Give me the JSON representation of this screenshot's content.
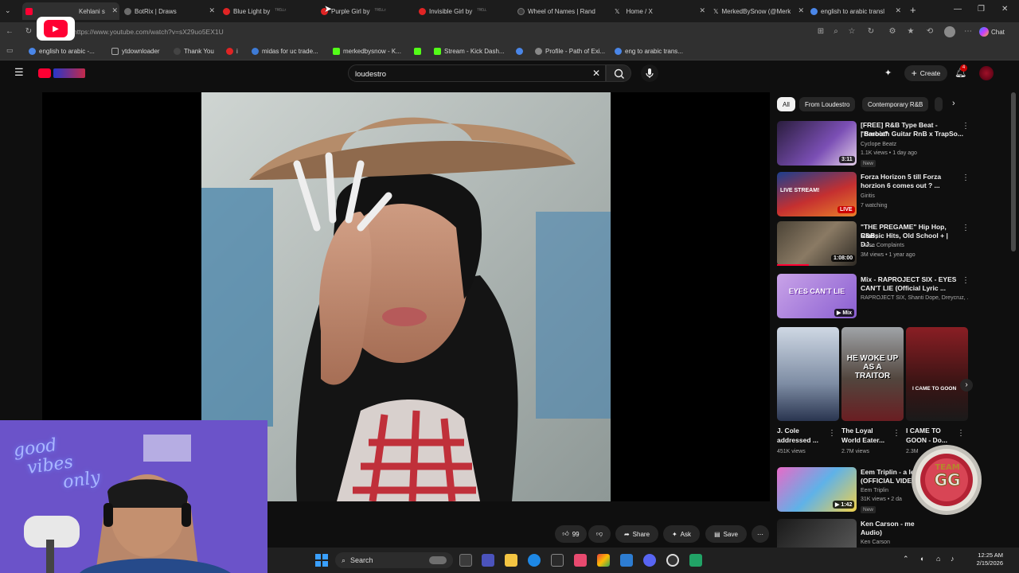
{
  "browser": {
    "tabs": [
      {
        "label": "Kehlani s",
        "color": "#ff0033"
      },
      {
        "label": "BotRix | Draws",
        "color": "#6c6c6c"
      },
      {
        "label": "Blue Light by",
        "color": "#e02424"
      },
      {
        "label": "Purple Girl by",
        "color": "#e02424"
      },
      {
        "label": "Invisible Girl by",
        "color": "#e02424"
      },
      {
        "label": "Wheel of Names | Rand",
        "color": "#3b3b3b"
      },
      {
        "label": "Home / X",
        "color": "#222222"
      },
      {
        "label": "MerkedBySnow (@Merk",
        "color": "#222222"
      },
      {
        "label": "english to arabic transl",
        "color": "#4a86e8"
      }
    ],
    "url": "https://www.youtube.com/watch?v=sX29uo5EX1U",
    "chat_label": "Chat",
    "bookmarks": [
      {
        "label": "english to arabic -...",
        "color": "#4a86e8"
      },
      {
        "label": "ytdownloader",
        "color": "#888888"
      },
      {
        "label": "Thank You",
        "color": "#444444"
      },
      {
        "label": "i",
        "color": "#e02424"
      },
      {
        "label": "midas for uc trade...",
        "color": "#3e7bd6"
      },
      {
        "label": "merkedbysnow - K...",
        "color": "#53fc18"
      },
      {
        "label": "",
        "color": "#53fc18"
      },
      {
        "label": "Stream - Kick Dash...",
        "color": "#53fc18"
      },
      {
        "label": "",
        "color": "#4a86e8"
      },
      {
        "label": "Profile - Path of Exi...",
        "color": "#888888"
      },
      {
        "label": "eng to arabic trans...",
        "color": "#4a86e8"
      }
    ]
  },
  "youtube": {
    "search_value": "loudestro",
    "create_label": "Create",
    "notification_count": "4",
    "chips": [
      "All",
      "From Loudestro",
      "Contemporary R&B"
    ],
    "actions": {
      "like_count": "99",
      "share_label": "Share",
      "ask_label": "Ask",
      "save_label": "Save"
    },
    "recommendations": [
      {
        "title": "[FREE] R&B Type Beat - \"Barbie\"",
        "title2": "| Smooth Guitar RnB x TrapSo...",
        "channel": "Cyclope Beatz",
        "meta": "1.1K views • 1 day ago",
        "badge": "New",
        "duration": "3:11"
      },
      {
        "title": "Forza Horizon 5 till Forza",
        "title2": "horzion 6 comes out ? ...",
        "channel": "Giritis",
        "meta": "7 watching",
        "badge": "",
        "duration": "LIVE"
      },
      {
        "title": "\"THE PREGAME\" Hip Hop, R&B,",
        "title2": "Classic Hits, Old School + | DJ...",
        "channel": "Noise Complaints",
        "meta": "3M views • 1 year ago",
        "badge": "",
        "duration": "1:08:00"
      },
      {
        "title": "Mix - RAPROJECT SIX - EYES",
        "title2": "CAN'T LIE (Official Lyric ...",
        "channel": "RAPROJECT SIX, Shanti Dope, Dreycruz, ...",
        "meta": "",
        "badge": "",
        "duration": "Mix"
      }
    ],
    "thumb_texts": {
      "eyes": "EYES CAN'T LIE",
      "woke": "HE WOKE UP AS A TRAITOR",
      "goon": "I CAME TO GOON",
      "forza": "LIVE STREAM!"
    },
    "shorts": [
      {
        "title": "J. Cole",
        "title2": "addressed ...",
        "meta": "451K views"
      },
      {
        "title": "The Loyal",
        "title2": "World Eater...",
        "meta": "2.7M views"
      },
      {
        "title": "I CAME TO",
        "title2": "GOON - Do...",
        "meta": "2.3M"
      }
    ],
    "more_recs": [
      {
        "title": "Eem Triplin - a le",
        "title2": "(OFFICIAL VIDE",
        "channel": "Eem Triplin",
        "meta": "31K views • 2 da",
        "badge": "New",
        "duration": "1:42"
      },
      {
        "title": "Ken Carson - me",
        "title2": "Audio)",
        "channel": "Ken Carson",
        "meta": "",
        "badge": "",
        "duration": ""
      }
    ]
  },
  "overlay": {
    "neon_text_1": "good",
    "neon_text_2": "vibes",
    "neon_text_3": "only",
    "logo_line1": "TEAM",
    "logo_line2": "GG"
  },
  "taskbar": {
    "search_label": "Search",
    "time": "12:25 AM",
    "date": "2/15/2026"
  }
}
